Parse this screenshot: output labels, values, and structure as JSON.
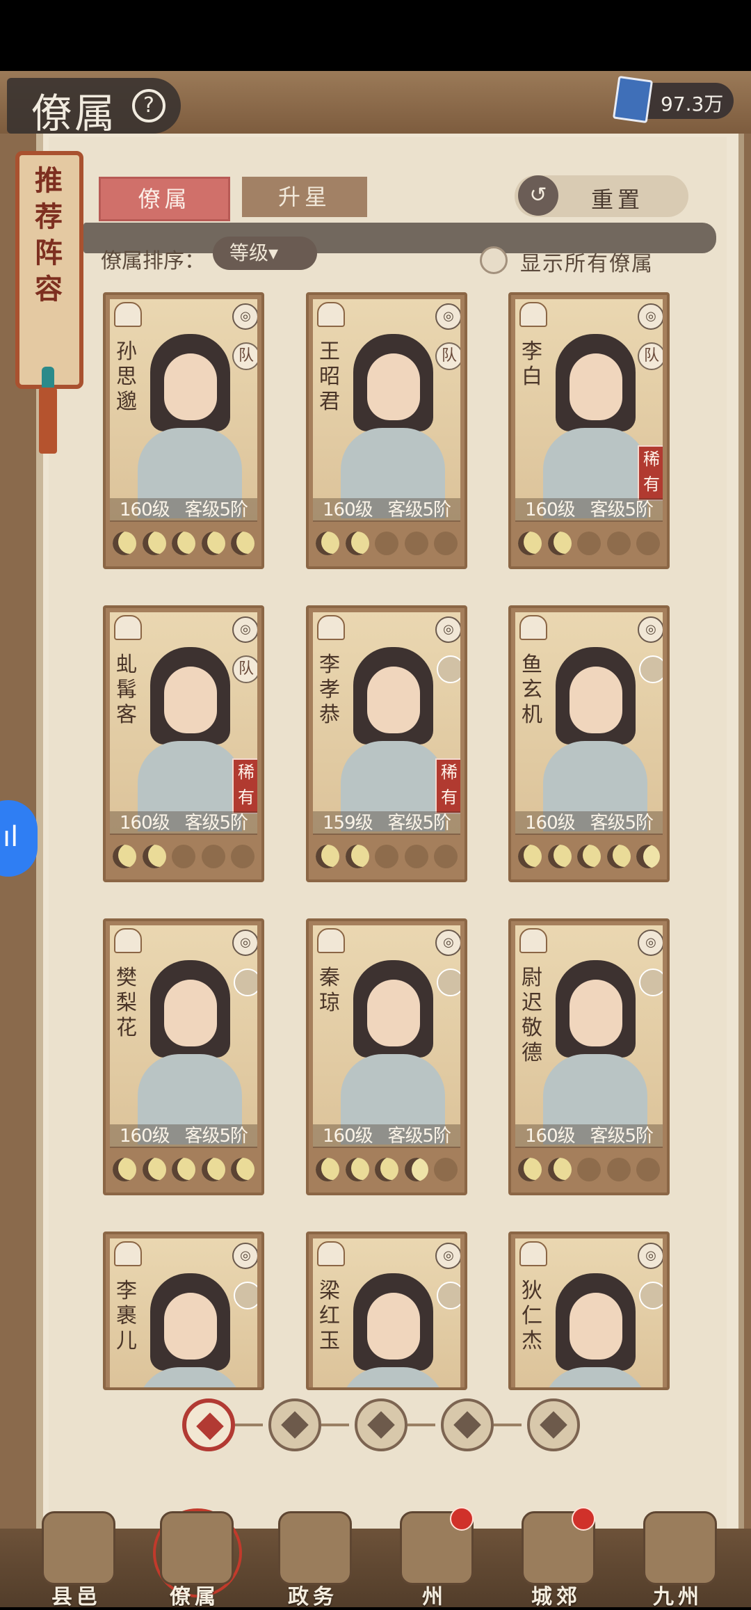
{
  "header": {
    "title": "僚属",
    "currency_value": "97.3万"
  },
  "recommend_tab": {
    "label": "推荐阵容"
  },
  "tabs": [
    {
      "label": "僚属"
    },
    {
      "label": "升星"
    }
  ],
  "reset": {
    "label": "重置"
  },
  "sort": {
    "label": "僚属排序：",
    "selected": "等级▾"
  },
  "show_all": {
    "label": "显示所有僚属",
    "checked": false
  },
  "cards": [
    {
      "name": "孙思邈",
      "level": "160级",
      "rank": "客级5阶",
      "team": "队",
      "rare": "",
      "moons": 5
    },
    {
      "name": "王昭君",
      "level": "160级",
      "rank": "客级5阶",
      "team": "队",
      "rare": "",
      "moons": 2
    },
    {
      "name": "李白",
      "level": "160级",
      "rank": "客级5阶",
      "team": "队",
      "rare": "稀有",
      "moons": 2
    },
    {
      "name": "虬髯客",
      "level": "160级",
      "rank": "客级5阶",
      "team": "队",
      "rare": "稀有",
      "moons": 2
    },
    {
      "name": "李孝恭",
      "level": "159级",
      "rank": "客级5阶",
      "team": "",
      "rare": "稀有",
      "moons": 2
    },
    {
      "name": "鱼玄机",
      "level": "160级",
      "rank": "客级5阶",
      "team": "",
      "rare": "",
      "moons": 4.5
    },
    {
      "name": "樊梨花",
      "level": "160级",
      "rank": "客级5阶",
      "team": "",
      "rare": "",
      "moons": 5
    },
    {
      "name": "秦琼",
      "level": "160级",
      "rank": "客级5阶",
      "team": "",
      "rare": "",
      "moons": 3.5
    },
    {
      "name": "尉迟敬德",
      "level": "160级",
      "rank": "客级5阶",
      "team": "",
      "rare": "",
      "moons": 2
    },
    {
      "name": "李裹儿",
      "level": "",
      "rank": "",
      "team": "",
      "rare": "",
      "moons": 0
    },
    {
      "name": "梁红玉",
      "level": "",
      "rank": "",
      "team": "",
      "rare": "",
      "moons": 0
    },
    {
      "name": "狄仁杰",
      "level": "",
      "rank": "",
      "team": "",
      "rare": "",
      "moons": 0
    }
  ],
  "filters": [
    {
      "icon": "all-filter-icon",
      "active": true
    },
    {
      "icon": "bell-filter-icon"
    },
    {
      "icon": "gourd-filter-icon"
    },
    {
      "icon": "fan-filter-icon"
    },
    {
      "icon": "lion-filter-icon"
    }
  ],
  "bottom_nav": [
    {
      "label": "县邑",
      "dot": false
    },
    {
      "label": "僚属",
      "dot": false,
      "active": true
    },
    {
      "label": "政务",
      "dot": false
    },
    {
      "label": "州",
      "dot": true
    },
    {
      "label": "城郊",
      "dot": true
    },
    {
      "label": "九州",
      "dot": false
    }
  ],
  "colors": {
    "accent": "#d0706a",
    "rare": "#b13a30",
    "paper": "#ebe1cd",
    "wood": "#8a6a4c"
  }
}
